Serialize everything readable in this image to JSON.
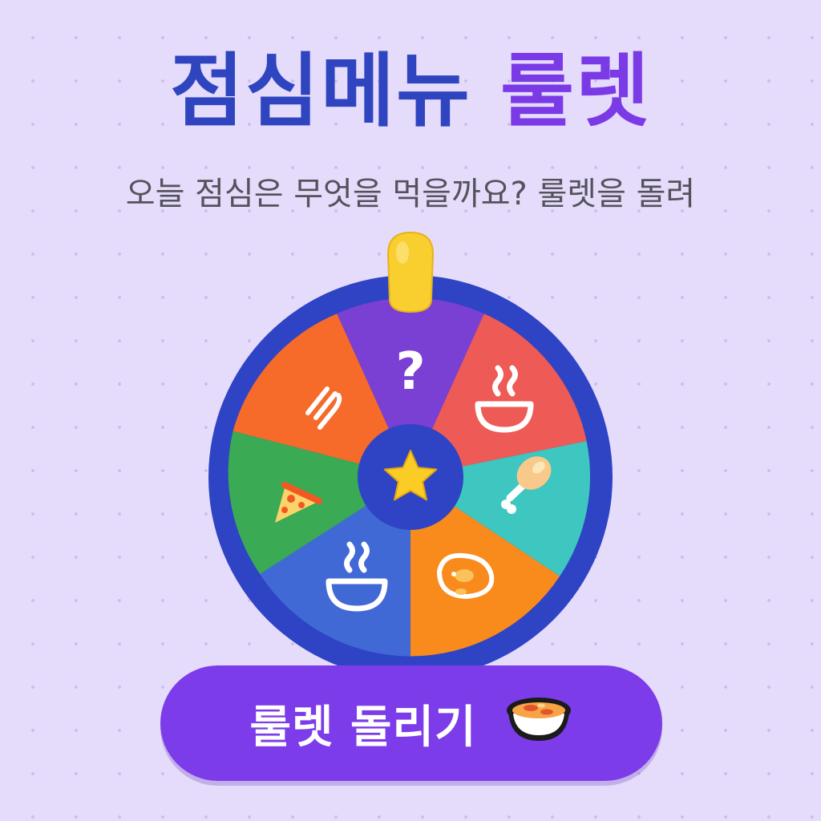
{
  "title": {
    "part1": "점심메뉴",
    "part2": "룰렛"
  },
  "subtitle": "오늘 점심은 무엇을 먹을까요? 룰렛을 돌려",
  "wheel": {
    "segments": [
      {
        "name": "mystery",
        "icon": "question-icon",
        "glyph": "?",
        "color": "#7a3fd3"
      },
      {
        "name": "soup",
        "icon": "bowl-icon",
        "color": "#ee5a55"
      },
      {
        "name": "chicken",
        "icon": "drumstick-icon",
        "color": "#3ec6c0"
      },
      {
        "name": "omelette",
        "icon": "omelette-icon",
        "color": "#f98b1c"
      },
      {
        "name": "noodle",
        "icon": "bowl-icon",
        "color": "#4169d6"
      },
      {
        "name": "pizza",
        "icon": "pizza-icon",
        "color": "#3aaa55"
      },
      {
        "name": "pasta",
        "icon": "fork-icon",
        "color": "#f66a2a"
      }
    ],
    "rim_color": "#2e44c4",
    "hub_color": "#2e44c4",
    "hub_icon": "star-icon",
    "pointer_color": "#f9ce2f"
  },
  "spin_button": {
    "label": "룰렛 돌리기",
    "icon": "food-bowl-icon"
  }
}
